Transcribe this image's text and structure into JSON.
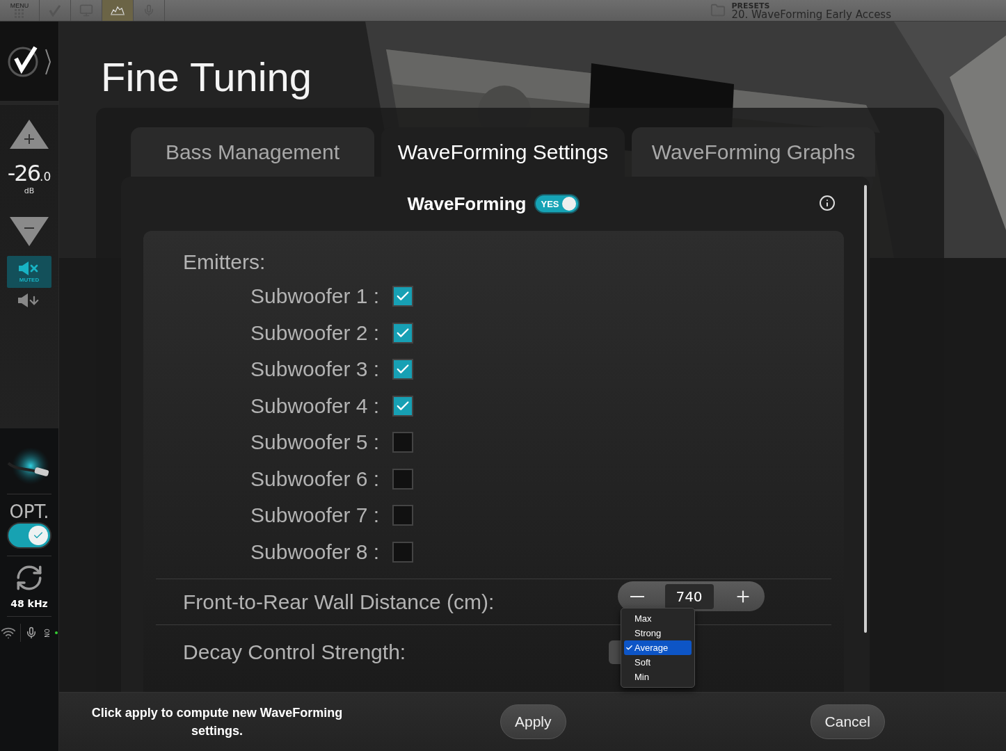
{
  "top_bar": {
    "menu_label": "MENU",
    "tools": [
      {
        "kind": "grid",
        "selected": false
      },
      {
        "kind": "check",
        "selected": false
      },
      {
        "kind": "screen",
        "selected": false
      },
      {
        "kind": "graph",
        "selected": true
      },
      {
        "kind": "mic",
        "selected": false
      }
    ],
    "presets_label": "PRESETS",
    "preset": "20. WaveForming Early Access"
  },
  "sidebar": {
    "volume_whole": "-26",
    "volume_decimal": ".0",
    "volume_unit": "dB",
    "muted": true,
    "mute_label": "MUTED",
    "opt_label": "OPT.",
    "opt_on": true,
    "sample_rate": "48 kHz",
    "power_label": "ON"
  },
  "title": "Fine Tuning",
  "tabs": [
    {
      "label": "Bass Management",
      "selected": false
    },
    {
      "label": "WaveForming Settings",
      "selected": true
    },
    {
      "label": "WaveForming Graphs",
      "selected": false
    }
  ],
  "waveforming": {
    "label": "WaveForming",
    "on": true,
    "on_label": "YES"
  },
  "emitters": {
    "label": "Emitters:",
    "items": [
      {
        "label": "Subwoofer 1 :",
        "checked": true
      },
      {
        "label": "Subwoofer 2 :",
        "checked": true
      },
      {
        "label": "Subwoofer 3 :",
        "checked": true
      },
      {
        "label": "Subwoofer 4 :",
        "checked": true
      },
      {
        "label": "Subwoofer 5 :",
        "checked": false
      },
      {
        "label": "Subwoofer 6 :",
        "checked": false
      },
      {
        "label": "Subwoofer 7 :",
        "checked": false
      },
      {
        "label": "Subwoofer 8 :",
        "checked": false
      }
    ]
  },
  "distance": {
    "label": "Front-to-Rear Wall Distance (cm):",
    "value": "740"
  },
  "decay": {
    "label": "Decay Control Strength:",
    "options": [
      {
        "label": "Max",
        "selected": false
      },
      {
        "label": "Strong",
        "selected": false
      },
      {
        "label": "Average",
        "selected": true
      },
      {
        "label": "Soft",
        "selected": false
      },
      {
        "label": "Min",
        "selected": false
      }
    ]
  },
  "footer": {
    "message": "Click apply to compute new WaveForming settings.",
    "apply": "Apply",
    "cancel": "Cancel"
  }
}
